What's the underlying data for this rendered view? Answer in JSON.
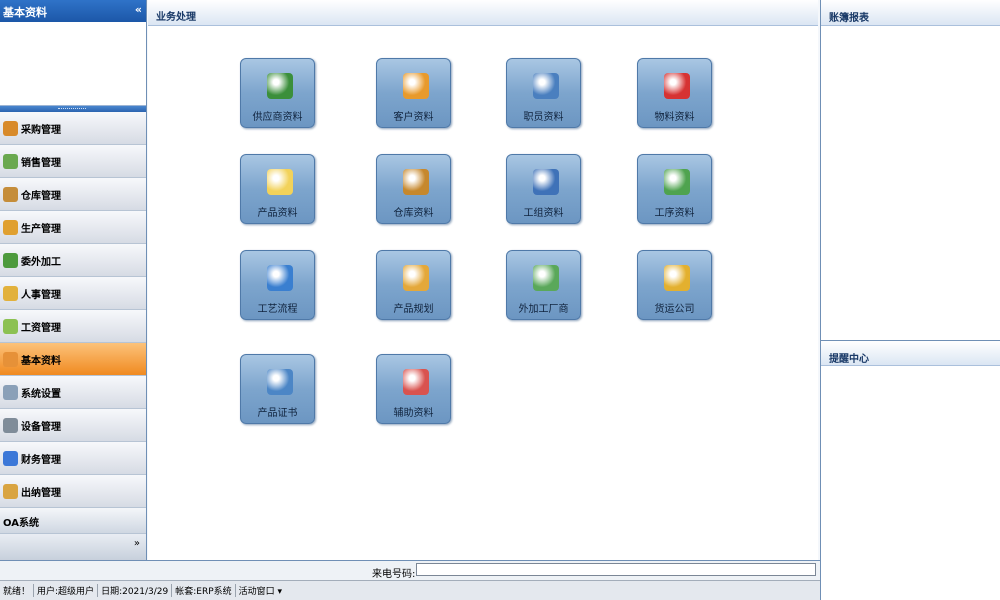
{
  "sidebar": {
    "title": "基本资料",
    "collapse_icon": "«",
    "items": [
      {
        "label": "采购管理",
        "color": "#d88a2a"
      },
      {
        "label": "销售管理",
        "color": "#6aa84f"
      },
      {
        "label": "仓库管理",
        "color": "#c58d3a"
      },
      {
        "label": "生产管理",
        "color": "#e0a030"
      },
      {
        "label": "委外加工",
        "color": "#4d9a3d"
      },
      {
        "label": "人事管理",
        "color": "#e2b13c"
      },
      {
        "label": "工资管理",
        "color": "#8cc152"
      },
      {
        "label": "基本资料",
        "color": "#e69138",
        "active": true
      },
      {
        "label": "系统设置",
        "color": "#8aa0b8"
      },
      {
        "label": "设备管理",
        "color": "#7f8c99"
      },
      {
        "label": "财务管理",
        "color": "#3c78d8"
      },
      {
        "label": "出纳管理",
        "color": "#d9a441"
      }
    ],
    "oa_label": "OA系统",
    "expand_icon": "»"
  },
  "main": {
    "title": "业务处理",
    "tiles": [
      {
        "label": "供应商资料",
        "icon": "id-card-icon",
        "color": "#3b8f3b"
      },
      {
        "label": "客户资料",
        "icon": "users-icon",
        "color": "#e89a2c"
      },
      {
        "label": "职员资料",
        "icon": "employee-card-icon",
        "color": "#4a7fbf"
      },
      {
        "label": "物料资料",
        "icon": "pie-icon",
        "color": "#d63333"
      },
      {
        "label": "产品资料",
        "icon": "document-icon",
        "color": "#f2d25a"
      },
      {
        "label": "仓库资料",
        "icon": "boxes-icon",
        "color": "#c6882d"
      },
      {
        "label": "工组资料",
        "icon": "globe-doc-icon",
        "color": "#3f72b8"
      },
      {
        "label": "工序资料",
        "icon": "clipboard-icon",
        "color": "#4fa34f"
      },
      {
        "label": "工艺流程",
        "icon": "flowchart-icon",
        "color": "#3a7fd0"
      },
      {
        "label": "产品规划",
        "icon": "gear-globe-icon",
        "color": "#e4a83a"
      },
      {
        "label": "外加工厂商",
        "icon": "house-icon",
        "color": "#5aa85a"
      },
      {
        "label": "货运公司",
        "icon": "truck-icon",
        "color": "#e3b02f"
      },
      {
        "label": "产品证书",
        "icon": "certificate-icon",
        "color": "#4c86c6"
      },
      {
        "label": "辅助资料",
        "icon": "pie-doc-icon",
        "color": "#d9534f"
      }
    ]
  },
  "right": {
    "reports_title": "账簿报表",
    "reminders_title": "提醒中心"
  },
  "callbar": {
    "label": "来电号码:"
  },
  "statusbar": {
    "ready": "就绪！",
    "user": "用户:超级用户",
    "date": "日期:2021/3/29",
    "account": "帐套:ERP系统",
    "window": "活动窗口 ▾"
  }
}
